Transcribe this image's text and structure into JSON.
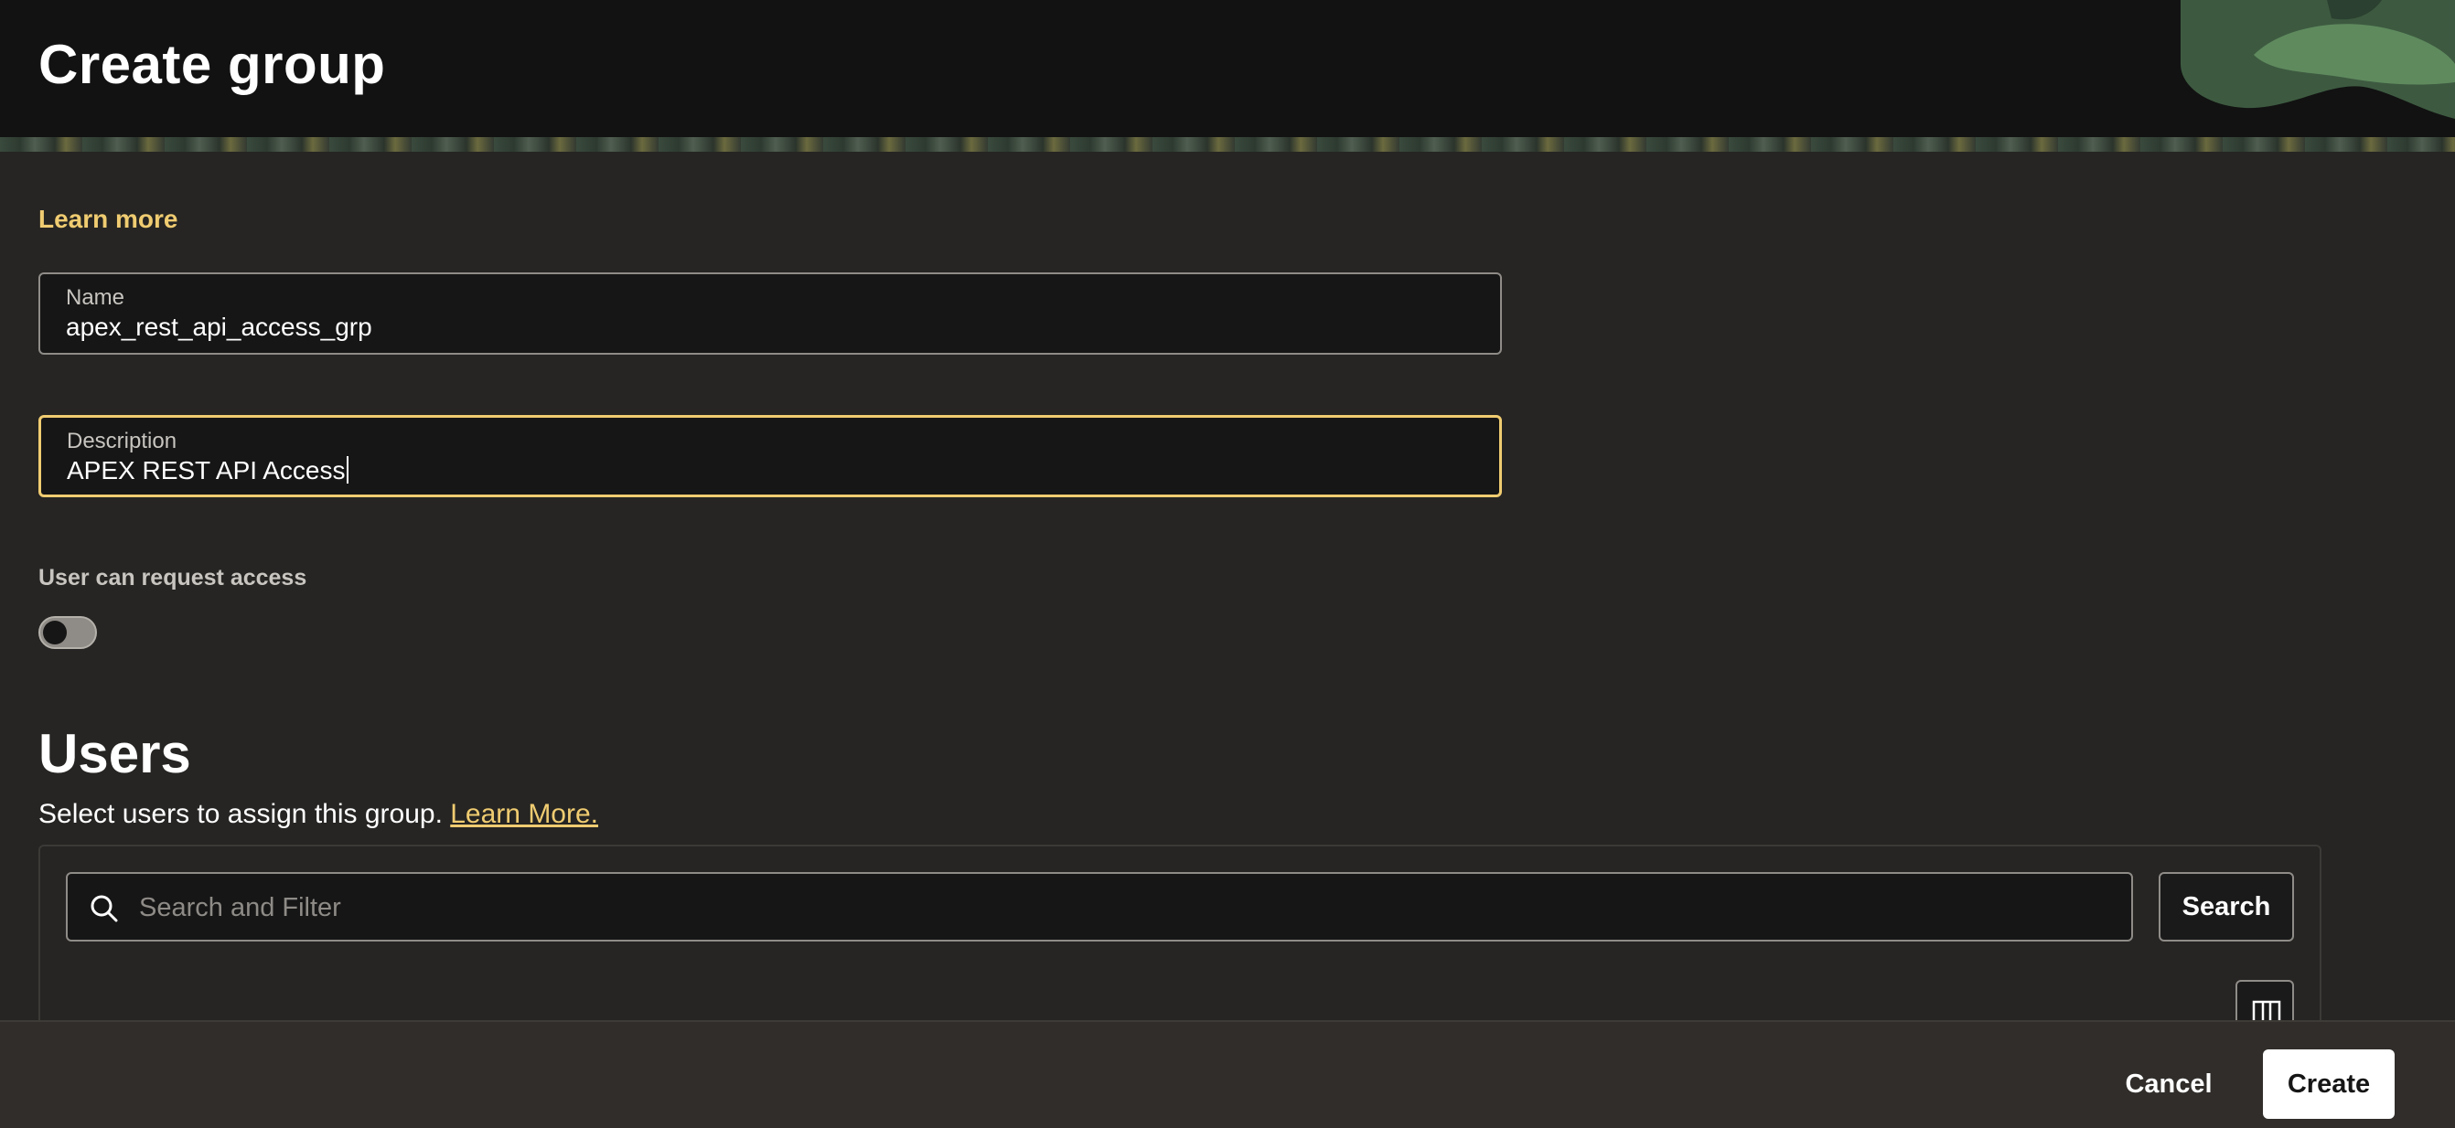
{
  "header": {
    "title": "Create group"
  },
  "form": {
    "learn_more": "Learn more",
    "name": {
      "label": "Name",
      "value": "apex_rest_api_access_grp"
    },
    "description": {
      "label": "Description",
      "value": "APEX REST API Access"
    },
    "request_access": {
      "label": "User can request access",
      "enabled": false
    }
  },
  "users": {
    "title": "Users",
    "description": "Select users to assign this group.",
    "learn_more_link": "Learn More.",
    "search": {
      "placeholder": "Search and Filter",
      "button_label": "Search"
    },
    "columns_icon": "columns-icon"
  },
  "footer": {
    "cancel_label": "Cancel",
    "create_label": "Create"
  },
  "colors": {
    "accent": "#f0cc71",
    "background": "#262523",
    "header": "#121212"
  }
}
